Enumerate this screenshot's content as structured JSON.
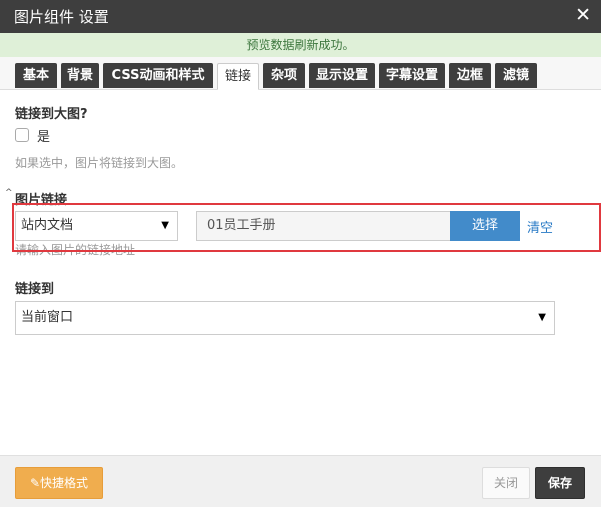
{
  "dialog": {
    "title": "图片组件 设置",
    "close_symbol": "✕"
  },
  "notice": "预览数据刷新成功。",
  "tabs": [
    {
      "label": "基本",
      "active": false
    },
    {
      "label": "背景",
      "active": false
    },
    {
      "label": "CSS动画和样式",
      "active": false
    },
    {
      "label": "链接",
      "active": true
    },
    {
      "label": "杂项",
      "active": false
    },
    {
      "label": "显示设置",
      "active": false
    },
    {
      "label": "字幕设置",
      "active": false
    },
    {
      "label": "边框",
      "active": false
    },
    {
      "label": "滤镜",
      "active": false
    }
  ],
  "link_to_big": {
    "title": "链接到大图?",
    "checkbox_label": "是",
    "checked": false,
    "help": "如果选中，图片将链接到大图。"
  },
  "image_link": {
    "title": "图片链接",
    "type_select": "站内文档",
    "value": "01员工手册",
    "choose_button": "选择",
    "clear_link": "清空",
    "help": "请输入图片的链接地址"
  },
  "link_target": {
    "title": "链接到",
    "selected": "当前窗口"
  },
  "footer": {
    "quick_format": "快捷格式",
    "close": "关闭",
    "save": "保存"
  },
  "colors": {
    "highlight": "#e0393f",
    "primary": "#428bca",
    "warning": "#f0ad4e",
    "dark": "#3e3e3e"
  }
}
